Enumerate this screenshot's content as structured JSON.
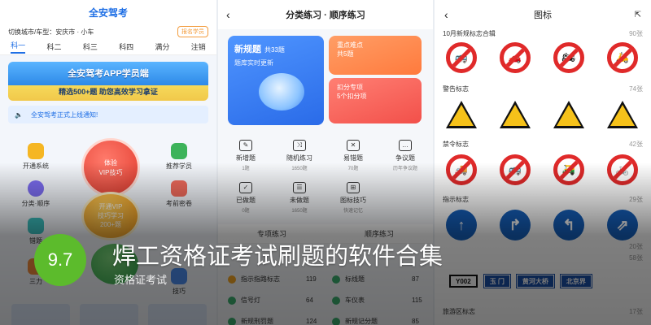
{
  "p1": {
    "title": "全安驾考",
    "city": "切换城市/车型：安庆市 · 小车",
    "vip_btn": "报名学员",
    "tabs": [
      "科一",
      "科二",
      "科三",
      "科四",
      "满分",
      "注销"
    ],
    "banner_line1": "全安驾考APP学员端",
    "banner_line2": "精选500+题 助您高效学习拿证",
    "notice": "全安驾考正式上线通知!",
    "grid": [
      "开通系统",
      "分类·顺序",
      "错题",
      "三力",
      "推荐学员",
      "考前密卷",
      "技巧"
    ],
    "red_circle": [
      "体验",
      "VIP技巧"
    ],
    "orange_circle": [
      "开通VIP",
      "技巧学习",
      "200+题"
    ]
  },
  "p2": {
    "title": "分类练习 · 顺序练习",
    "card_blue_title": "新规题",
    "card_blue_count": "共33题",
    "card_blue_sub": "题库实时更新",
    "card_o1_title": "重点难点",
    "card_o1_sub": "共5题",
    "card_o2_title": "扣分专项",
    "card_o2_sub": "5个扣分项",
    "icons": [
      {
        "label": "新增题",
        "sub": "1题"
      },
      {
        "label": "随机练习",
        "sub": "1650题"
      },
      {
        "label": "易错题",
        "sub": "70题"
      },
      {
        "label": "争议题",
        "sub": "历年争议题"
      },
      {
        "label": "已做题",
        "sub": "0题"
      },
      {
        "label": "未做题",
        "sub": "1650题"
      },
      {
        "label": "图标技巧",
        "sub": "快速记忆"
      }
    ],
    "tab_left": "专项练习",
    "tab_right": "顺序练习",
    "rows": [
      {
        "l": "指示指路标志",
        "ln": "119",
        "r": "标线题",
        "rn": "87"
      },
      {
        "l": "信号灯",
        "ln": "64",
        "r": "车仪表",
        "rn": "115"
      },
      {
        "l": "新规刑罚题",
        "ln": "124",
        "r": "新规记分题",
        "rn": "85"
      }
    ]
  },
  "p3": {
    "title": "图标",
    "sections": [
      {
        "name": "10月新规标志合辑",
        "count": "90张"
      },
      {
        "name": "警告标志",
        "count": "74张"
      },
      {
        "name": "禁令标志",
        "count": "42张"
      },
      {
        "name": "指示标志",
        "count": "29张"
      },
      {
        "name": "旅游区标志",
        "count": "17张"
      }
    ],
    "hidden_counts": [
      "20张",
      "58张"
    ],
    "road_signs": [
      "Y002",
      "玉 门",
      "黄河大桥",
      "北京界"
    ]
  },
  "overlay": {
    "score": "9.7",
    "title": "焊工资格证考试刷题的软件合集",
    "subtitle": "资格证考试"
  },
  "colors": {
    "accent": "#1f6fe5",
    "score_green": "#5cbb2c",
    "sign_red": "#e02a2a",
    "sign_blue": "#1560bd"
  }
}
